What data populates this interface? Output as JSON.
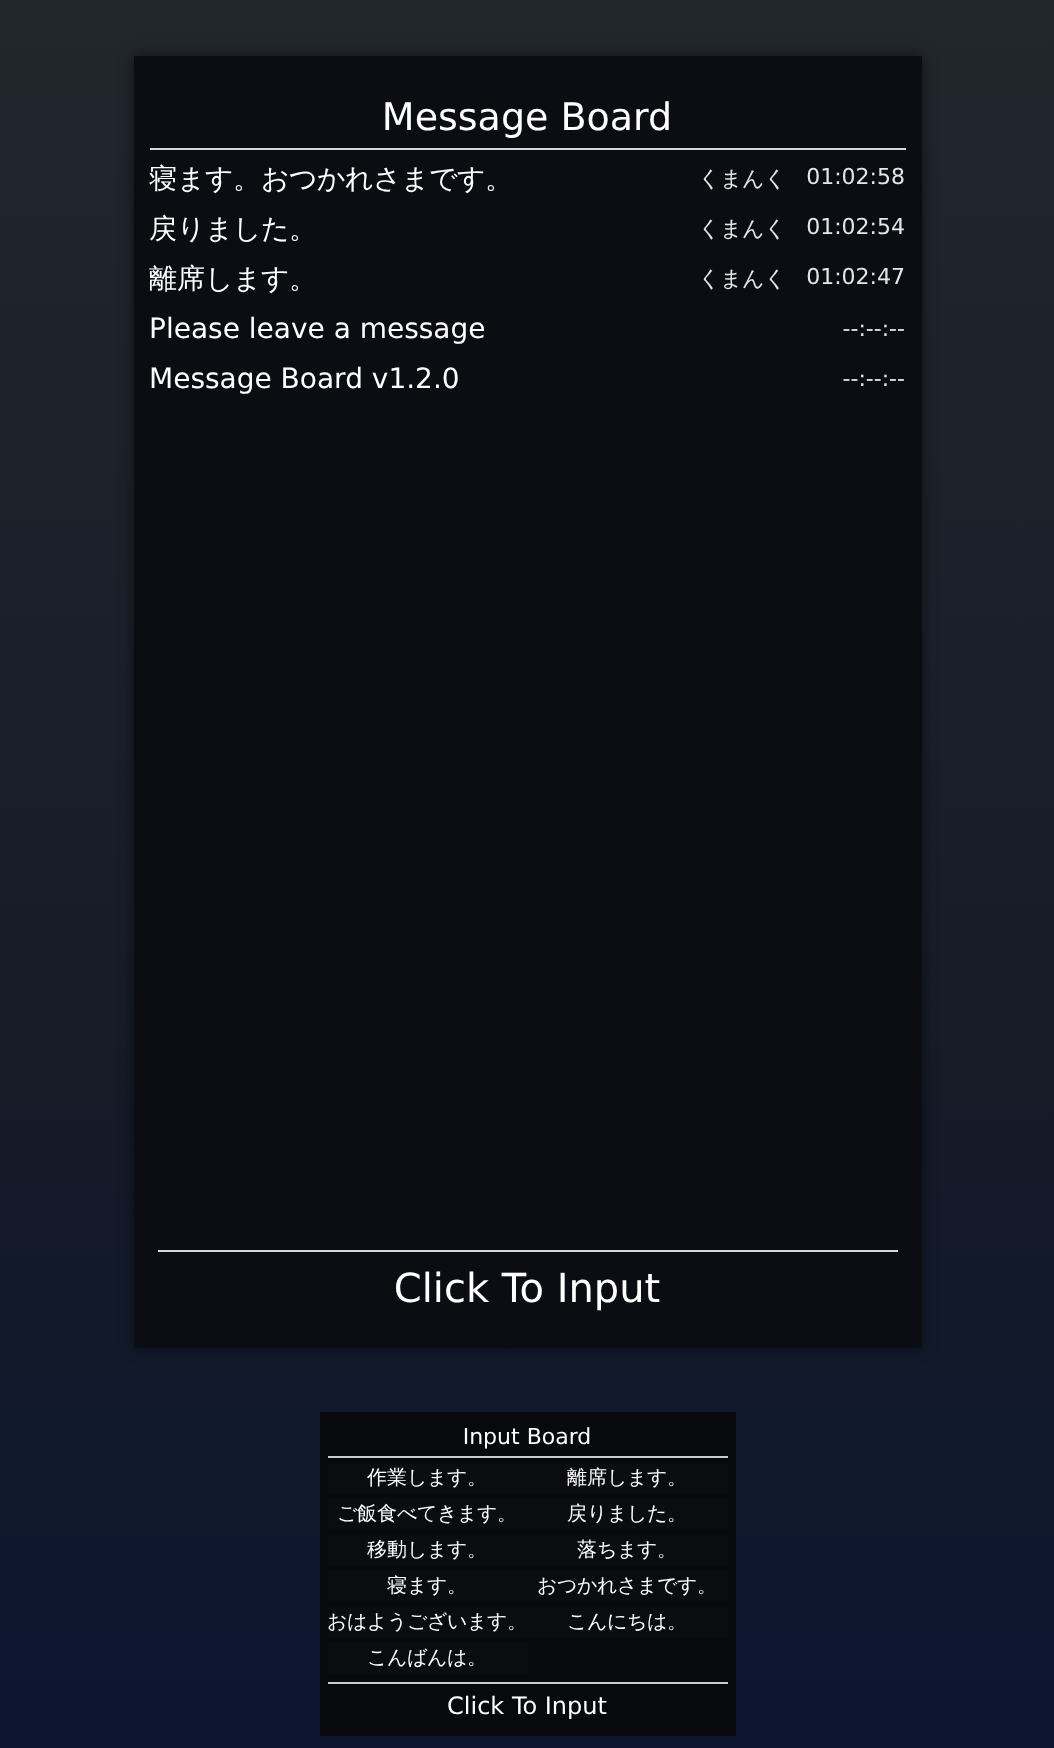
{
  "message_board": {
    "title": "Message Board",
    "messages": [
      {
        "text": "寝ます。おつかれさまです。",
        "author": "くまんく",
        "time": "01:02:58"
      },
      {
        "text": "戻りました。",
        "author": "くまんく",
        "time": "01:02:54"
      },
      {
        "text": "離席します。",
        "author": "くまんく",
        "time": "01:02:47"
      },
      {
        "text": "Please leave a message",
        "time": "--:--:--"
      },
      {
        "text": "Message Board v1.2.0",
        "time": "--:--:--"
      }
    ],
    "input_button": "Click To Input"
  },
  "input_board": {
    "title": "Input Board",
    "left_phrases": [
      "作業します。",
      "ご飯食べてきます。",
      "移動します。",
      "寝ます。",
      "おはようございます。",
      "こんばんは。"
    ],
    "right_phrases": [
      "離席します。",
      "戻りました。",
      "落ちます。",
      "おつかれさまです。",
      "こんにちは。"
    ],
    "input_button": "Click To Input"
  }
}
